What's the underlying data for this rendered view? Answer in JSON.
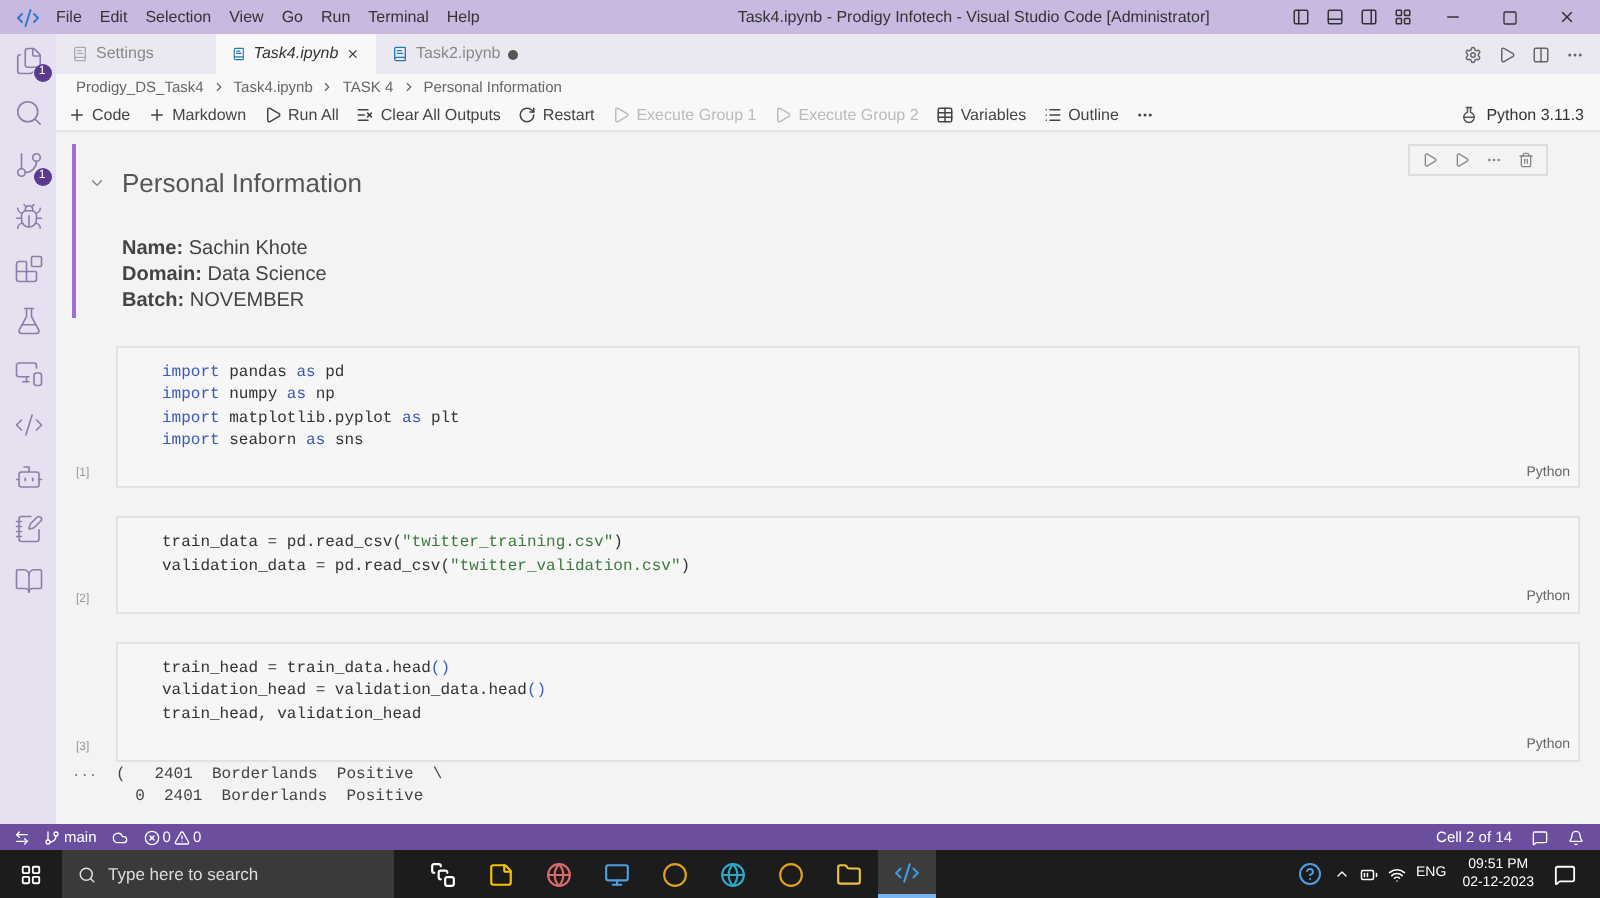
{
  "menu": [
    "File",
    "Edit",
    "Selection",
    "View",
    "Go",
    "Run",
    "Terminal",
    "Help"
  ],
  "window": {
    "title": "Task4.ipynb - Prodigy Infotech - Visual Studio Code [Administrator]"
  },
  "activity": [
    {
      "kind": "files",
      "badge": "1"
    },
    {
      "kind": "search"
    },
    {
      "kind": "git",
      "badge": "1"
    },
    {
      "kind": "run"
    },
    {
      "kind": "extensions"
    },
    {
      "kind": "flask"
    },
    {
      "kind": "remote"
    },
    {
      "kind": "python"
    },
    {
      "kind": "ai"
    },
    {
      "kind": "notebook"
    },
    {
      "kind": "book"
    }
  ],
  "tabs": [
    {
      "label": "Settings",
      "selected": false,
      "modified": false
    },
    {
      "label": "Task4.ipynb",
      "selected": true,
      "modified": false
    },
    {
      "label": "Task2.ipynb",
      "selected": false,
      "modified": true
    }
  ],
  "breadcrumb": [
    "Prodigy_DS_Task4",
    "Task4.ipynb",
    "TASK 4",
    "Personal Information"
  ],
  "toolbar": [
    {
      "kind": "plus",
      "label": "Code",
      "disabled": false
    },
    {
      "kind": "plus",
      "label": "Markdown",
      "disabled": false
    },
    {
      "kind": "run",
      "label": "Run All",
      "disabled": false
    },
    {
      "kind": "clear",
      "label": "Clear All Outputs",
      "disabled": false
    },
    {
      "kind": "restart",
      "label": "Restart",
      "disabled": false
    },
    {
      "kind": "group",
      "label": "Execute Group 1",
      "disabled": true
    },
    {
      "kind": "group",
      "label": "Execute Group 2",
      "disabled": true
    },
    {
      "kind": "variables",
      "label": "Variables",
      "disabled": false
    },
    {
      "kind": "outline",
      "label": "Outline",
      "disabled": false
    }
  ],
  "kernel": "Python 3.11.3",
  "markdown_cell": {
    "heading": "Personal Information",
    "lines": [
      "**Name:** Sachin Khote",
      "**Domain:** Data Science",
      "**Batch:** NOVEMBER"
    ]
  },
  "code_cells": [
    {
      "count": "[1]",
      "language": "Python",
      "lines": [
        [
          {
            "text": "import",
            "kind": "keyword"
          },
          {
            "text": " pandas ",
            "kind": "name"
          },
          {
            "text": "as",
            "kind": "keyword"
          },
          {
            "text": " pd",
            "kind": "name"
          }
        ],
        [
          {
            "text": "import",
            "kind": "keyword"
          },
          {
            "text": " numpy ",
            "kind": "name"
          },
          {
            "text": "as",
            "kind": "keyword"
          },
          {
            "text": " np",
            "kind": "name"
          }
        ],
        [
          {
            "text": "import",
            "kind": "keyword"
          },
          {
            "text": " matplotlib.pyplot ",
            "kind": "name"
          },
          {
            "text": "as",
            "kind": "keyword"
          },
          {
            "text": " plt",
            "kind": "name"
          }
        ],
        [
          {
            "text": "import",
            "kind": "keyword"
          },
          {
            "text": " seaborn ",
            "kind": "name"
          },
          {
            "text": "as",
            "kind": "keyword"
          },
          {
            "text": " sns",
            "kind": "name"
          }
        ]
      ]
    },
    {
      "count": "[2]",
      "language": "Python",
      "lines": [
        [
          {
            "text": "train_data = pd.read_csv(",
            "kind": "name"
          },
          {
            "text": "\"twitter_training.csv\"",
            "kind": "string"
          },
          {
            "text": ")",
            "kind": "name"
          }
        ],
        [
          {
            "text": "validation_data = pd.read_csv(",
            "kind": "name"
          },
          {
            "text": "\"twitter_validation.csv\"",
            "kind": "string"
          },
          {
            "text": ")",
            "kind": "name"
          }
        ]
      ]
    },
    {
      "count": "[3]",
      "language": "Python",
      "lines": [
        [
          {
            "text": "train_head = train_data.head",
            "kind": "name"
          },
          {
            "text": "()",
            "kind": "bracket"
          }
        ],
        [
          {
            "text": "validation_head = validation_data.head",
            "kind": "name"
          },
          {
            "text": "()",
            "kind": "bracket"
          }
        ],
        [
          {
            "text": "train_head, validation_head",
            "kind": "name"
          }
        ]
      ]
    }
  ],
  "output": {
    "marker": "...",
    "lines": [
      "(   2401  Borderlands  Positive  \\",
      "  0  2401  Borderlands  Positive"
    ]
  },
  "status_bar": {
    "branch": "main",
    "errors": "0",
    "warnings": "0",
    "cell": "Cell 2 of 14"
  },
  "taskbar": {
    "search_placeholder": "Type here to search",
    "apps": [
      {
        "kind": "taskview",
        "selected": false
      },
      {
        "kind": "sticky",
        "selected": false
      },
      {
        "kind": "app",
        "selected": false
      },
      {
        "kind": "app2",
        "selected": false
      },
      {
        "kind": "chrome",
        "selected": false
      },
      {
        "kind": "edge",
        "selected": false
      },
      {
        "kind": "chrome",
        "selected": false
      },
      {
        "kind": "folder",
        "selected": false
      },
      {
        "kind": "vscode",
        "selected": true
      }
    ],
    "language": "ENG",
    "time": "09:51 PM",
    "date": "02-12-2023"
  }
}
